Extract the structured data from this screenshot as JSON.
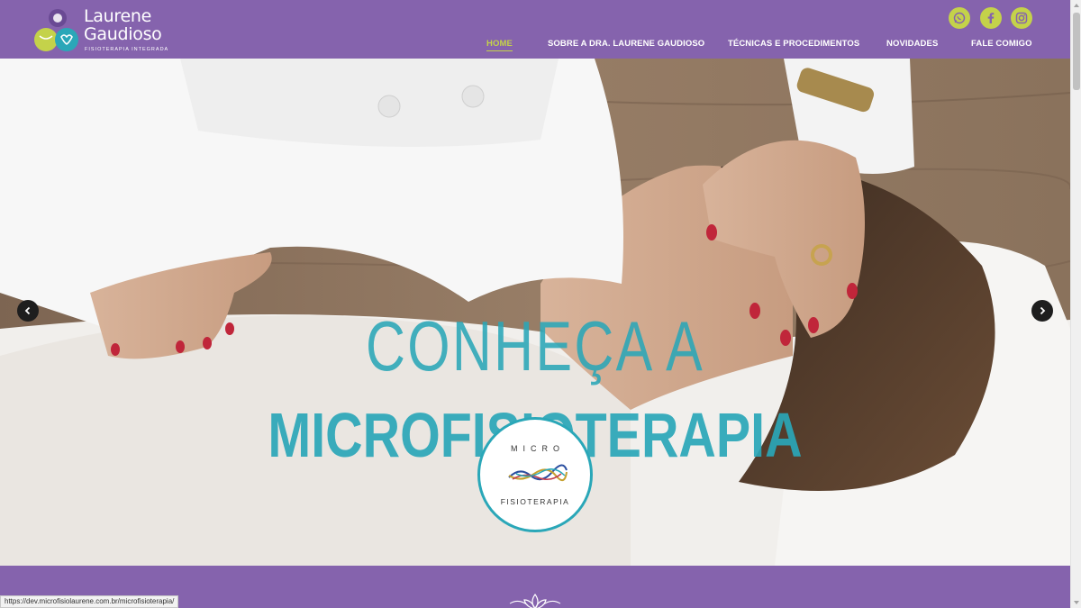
{
  "brand": {
    "name_line1": "Laurene",
    "name_line2": "Gaudioso",
    "tagline": "FISIOTERAPIA INTEGRADA"
  },
  "social": [
    {
      "icon": "whatsapp-icon"
    },
    {
      "icon": "facebook-icon"
    },
    {
      "icon": "instagram-icon"
    }
  ],
  "nav": {
    "items": [
      {
        "label": "HOME",
        "active": true
      },
      {
        "label": "SOBRE A DRA. LAURENE GAUDIOSO",
        "active": false
      },
      {
        "label": "TÉCNICAS E PROCEDIMENTOS",
        "active": false
      },
      {
        "label": "NOVIDADES",
        "active": false
      },
      {
        "label": "FALE COMIGO",
        "active": false
      }
    ]
  },
  "hero": {
    "line1": "CONHEÇA A",
    "line2": "MICROFISIOTERAPIA",
    "badge_top": "MICRO",
    "badge_bottom": "FISIOTERAPIA",
    "prev_icon": "chevron-left-icon",
    "next_icon": "chevron-right-icon"
  },
  "status_bar": {
    "url": "https://dev.microfisiolaurene.com.br/microfisioterapia/"
  },
  "colors": {
    "header_bg": "#8563ad",
    "accent_green": "#c4d24a",
    "hero_text": "#2aa7b8"
  }
}
